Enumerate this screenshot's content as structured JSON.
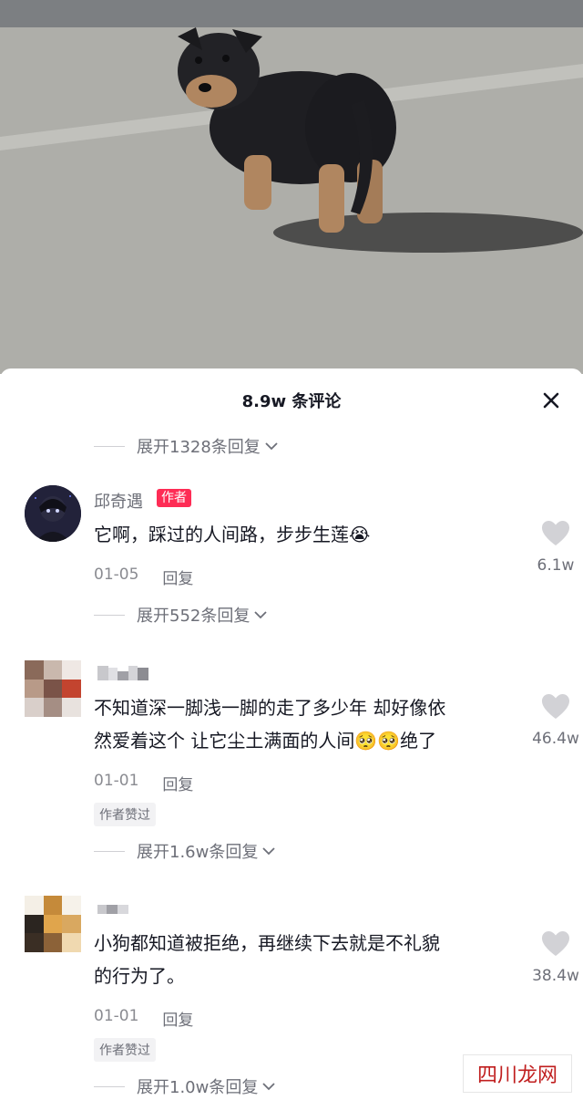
{
  "sheet": {
    "title": "8.9w 条评论"
  },
  "comments": [
    {
      "username": "邱奇遇",
      "author_tag": "作者",
      "text": "它啊，踩过的人间路，步步生莲😭",
      "date": "01-05",
      "reply_label": "回复",
      "likes": "6.1w",
      "expand_before": "展开1328条回复",
      "expand_after": "展开552条回复"
    },
    {
      "username": "",
      "text_line1": "不知道深一脚浅一脚的走了多少年 却好像依",
      "text_line2": "然爱着这个 让它尘土满面的人间🥺🥺绝了",
      "date": "01-01",
      "reply_label": "回复",
      "liked_badge": "作者赞过",
      "likes": "46.4w",
      "expand_after": "展开1.6w条回复"
    },
    {
      "username": "",
      "text_line1": "小狗都知道被拒绝，再继续下去就是不礼貌",
      "text_line2": "的行为了。",
      "date": "01-01",
      "reply_label": "回复",
      "liked_badge": "作者赞过",
      "likes": "38.4w",
      "expand_after": "展开1.0w条回复"
    }
  ],
  "icons": {
    "close": "close-icon",
    "heart": "heart-icon",
    "chevron": "chevron-down-icon"
  },
  "watermark": "四川龙网",
  "colors": {
    "author_tag": "#fe2c55",
    "text_primary": "#161823",
    "text_secondary": "#6d6f78",
    "heart": "#d2d2d6"
  }
}
